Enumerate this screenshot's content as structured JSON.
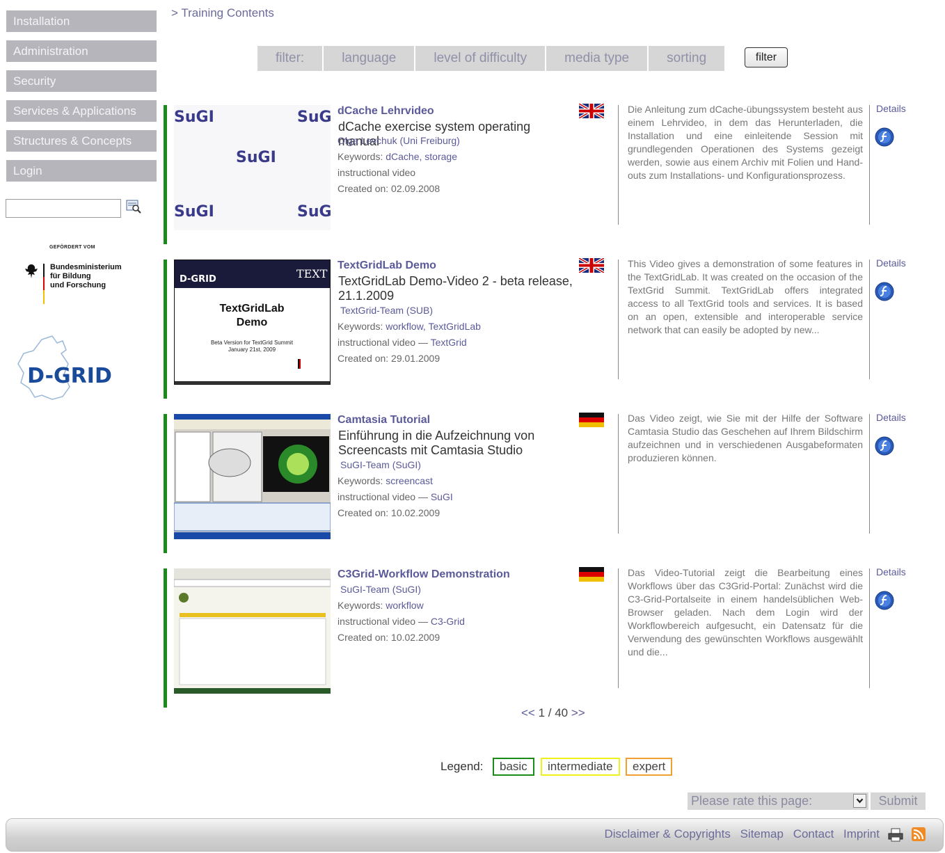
{
  "breadcrumb": "> Training Contents",
  "sidebar": {
    "items": [
      {
        "label": "Installation"
      },
      {
        "label": "Administration"
      },
      {
        "label": "Security"
      },
      {
        "label": "Services & Applications"
      },
      {
        "label": "Structures & Concepts"
      },
      {
        "label": "Login"
      }
    ],
    "search_value": "",
    "sponsor_heading": "GEFÖRDERT VOM",
    "sponsor_name_line1": "Bundesministerium",
    "sponsor_name_line2": "für Bildung",
    "sponsor_name_line3": "und Forschung",
    "dgrid_logo": "D-GRID"
  },
  "filter": {
    "label": "filter:",
    "options": [
      "language",
      "level of difficulty",
      "media type",
      "sorting"
    ],
    "button_label": "filter"
  },
  "entries": [
    {
      "title": "dCache Lehrvideo",
      "subtitle": "dCache exercise system operating manual",
      "author": "Olga Levchuk (Uni Freiburg)",
      "keywords_label": "Keywords:",
      "keywords": "dCache, storage",
      "media": "instructional video",
      "media_link": "",
      "created": "Created on: 02.09.2008",
      "language": "english-flag",
      "level_color": "#1a8a1a",
      "description": "Die Anleitung zum dCache-übungssystem besteht aus einem Lehrvideo, in dem das Herunterladen, die Installation und eine einleitende Session mit grundlegenden Operationen des Systems gezeigt werden, sowie aus einem Archiv mit Folien und Hand-outs zum Installations- und Konfigurationsprozess.",
      "details_label": "Details"
    },
    {
      "title": "TextGridLab Demo",
      "subtitle": "TextGridLab Demo-Video 2 - beta release, 21.1.2009",
      "author": "TextGrid-Team (SUB)",
      "keywords_label": "Keywords:",
      "keywords": "workflow, TextGridLab",
      "media": "instructional video",
      "media_link": "TextGrid",
      "created": "Created on: 29.01.2009",
      "language": "english-flag",
      "level_color": "#1a8a1a",
      "description": "This Video gives a demonstration of some features in the TextGridLab. It was created on the occasion of the TextGrid Summit. TextGridLab offers integrated access to all TextGrid tools and services. It is based on an open, extensible and interoperable service network that can easily be adopted by new...",
      "details_label": "Details",
      "thumb_heading": "TextGridLab",
      "thumb_heading2": "Demo",
      "thumb_sub": "Beta Version for TextGrid Summit",
      "thumb_sub2": "January 21st, 2009",
      "thumb_logo_left": "D-GRID",
      "thumb_logo_right": "TEXT"
    },
    {
      "title": "Camtasia Tutorial",
      "subtitle": "Einführung in die Aufzeichnung von Screencasts mit Camtasia Studio",
      "author": "SuGI-Team (SuGI)",
      "keywords_label": "Keywords:",
      "keywords": "screencast",
      "media": "instructional video",
      "media_link": "SuGI",
      "created": "Created on: 10.02.2009",
      "language": "german-flag",
      "level_color": "#1a8a1a",
      "description": "Das Video zeigt, wie Sie mit der Hilfe der Software Camtasia Studio das Geschehen auf Ihrem Bildschirm aufzeichnen und in verschiedenen Ausgabeformaten produzieren können.",
      "details_label": "Details"
    },
    {
      "title": "C3Grid-Workflow Demonstration",
      "subtitle": "",
      "author": "SuGI-Team (SuGI)",
      "keywords_label": "Keywords:",
      "keywords": "workflow",
      "media": "instructional video",
      "media_link": "C3-Grid",
      "created": "Created on: 10.02.2009",
      "language": "german-flag",
      "level_color": "#1a8a1a",
      "description": "Das Video-Tutorial zeigt die Bearbeitung eines Workflows über das C3Grid-Portal: Zunächst wird die C3-Grid-Portalseite in einem handelsüblichen Web-Browser geladen. Nach dem Login wird der Workflowbereich aufgesucht, ein Datensatz für die Verwendung des gewünschten Workflows ausgewählt und die...",
      "details_label": "Details"
    }
  ],
  "pager": {
    "prev": "<<",
    "current": "1 / 40",
    "next": ">>"
  },
  "legend": {
    "label": "Legend:",
    "items": [
      {
        "label": "basic",
        "color": "#1a8a1a"
      },
      {
        "label": "intermediate",
        "color": "#f0f020"
      },
      {
        "label": "expert",
        "color": "#f0a030"
      }
    ]
  },
  "rating": {
    "select_value": "Please rate this page:",
    "submit_label": "Submit"
  },
  "footer": {
    "links": [
      "Disclaimer & Copyrights",
      "Sitemap",
      "Contact",
      "Imprint"
    ]
  }
}
